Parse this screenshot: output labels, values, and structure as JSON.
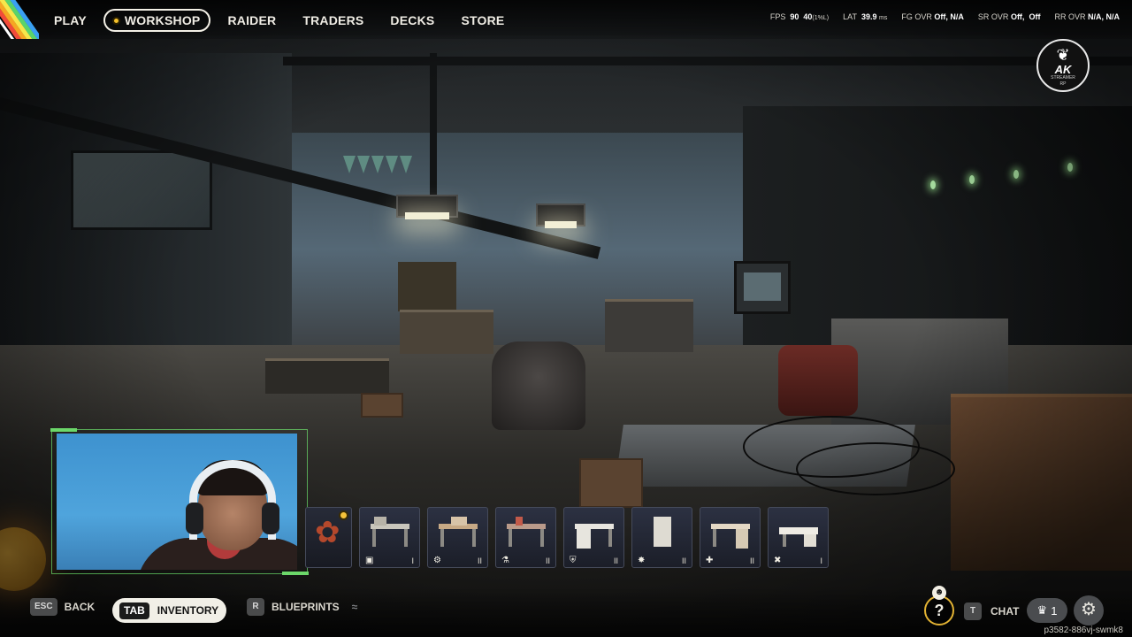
{
  "nav": {
    "items": [
      {
        "label": "PLAY"
      },
      {
        "label": "WORKSHOP",
        "active": true
      },
      {
        "label": "RAIDER"
      },
      {
        "label": "TRADERS"
      },
      {
        "label": "DECKS"
      },
      {
        "label": "STORE"
      }
    ]
  },
  "stats": {
    "fps_label": "FPS",
    "fps_value": "90",
    "fps_low_value": "40",
    "fps_low_suffix": "(1%L)",
    "lat_label": "LAT",
    "lat_value": "39.9",
    "lat_unit": "ms",
    "fg_label": "FG OVR",
    "fg_value": "Off,",
    "fg_value2": "N/A",
    "sr_label": "SR OVR",
    "sr_value": "Off,",
    "sr_value2": "Off",
    "rr_label": "RR OVR",
    "rr_value": "N/A,",
    "rr_value2": "N/A"
  },
  "badge": {
    "title": "AK",
    "subtitle": "STREAMER",
    "subtitle2": "RP"
  },
  "hotbar": {
    "rooster_slot": {
      "icon": "rooster-icon"
    },
    "slots": [
      {
        "name": "bench-1",
        "category_icon": "workbench-icon",
        "level": "I"
      },
      {
        "name": "bench-2",
        "category_icon": "gear-cog-icon",
        "level": "II"
      },
      {
        "name": "bench-3",
        "category_icon": "flask-icon",
        "level": "II"
      },
      {
        "name": "bench-4",
        "category_icon": "shield-icon",
        "level": "II"
      },
      {
        "name": "bench-5",
        "category_icon": "explosive-icon",
        "level": "II"
      },
      {
        "name": "bench-6",
        "category_icon": "medical-cross-icon",
        "level": "II"
      },
      {
        "name": "bench-7",
        "category_icon": "crossed-tools-icon",
        "level": "I"
      }
    ]
  },
  "bottom": {
    "back_key": "ESC",
    "back_label": "BACK",
    "inventory_key": "TAB",
    "inventory_label": "INVENTORY",
    "blueprints_key": "R",
    "blueprints_label": "BLUEPRINTS",
    "help_label": "?",
    "chat_key": "T",
    "chat_label": "CHAT",
    "friends_count": "1",
    "session_id": "p3582-886vj-swmk8"
  },
  "colors": {
    "accent": "#f5c12b",
    "webcam_border": "#6cd86a",
    "stripe_colors": [
      "#f24b3a",
      "#f5a623",
      "#f7e64a",
      "#5ad36a",
      "#3aa0f2",
      "#ffffff"
    ]
  }
}
